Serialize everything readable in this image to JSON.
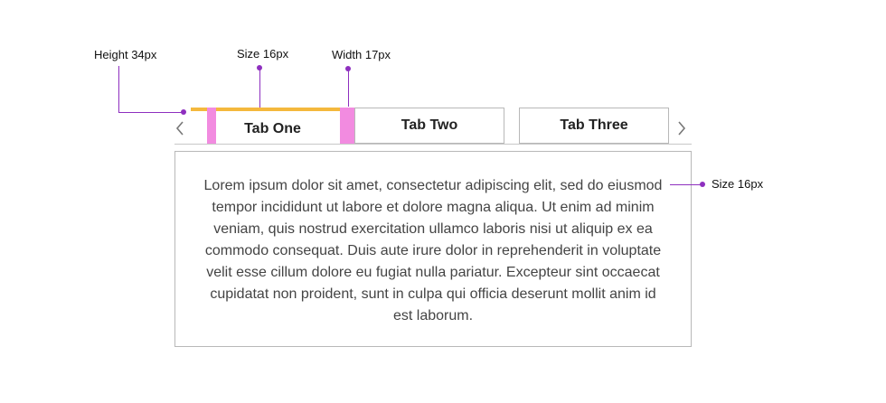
{
  "annotations": {
    "height": "Height 34px",
    "tab_text_size": "Size 16px",
    "width": "Width 17px",
    "content_text_size": "Size 16px"
  },
  "tabs": [
    {
      "label": "Tab One",
      "active": true
    },
    {
      "label": "Tab Two",
      "active": false
    },
    {
      "label": "Tab Three",
      "active": false
    }
  ],
  "icons": {
    "prev": "chevron-left-icon",
    "next": "chevron-right-icon"
  },
  "content": {
    "text": "Lorem ipsum dolor sit amet, consectetur adipiscing elit, sed do eiusmod tempor incididunt ut labore et dolore magna aliqua. Ut enim ad minim veniam, quis nostrud exercitation ullamco laboris nisi ut aliquip ex ea commodo consequat. Duis aute irure dolor in reprehenderit in voluptate velit esse cillum dolore eu fugiat nulla pariatur. Excepteur sint occaecat cupidatat non proident, sunt in culpa qui officia deserunt mollit anim id est laborum."
  },
  "colors": {
    "active_indicator": "#f4b83d",
    "spacing_highlight": "#f28be0",
    "annotation": "#8e2fbf",
    "border": "#b8b8b8"
  }
}
